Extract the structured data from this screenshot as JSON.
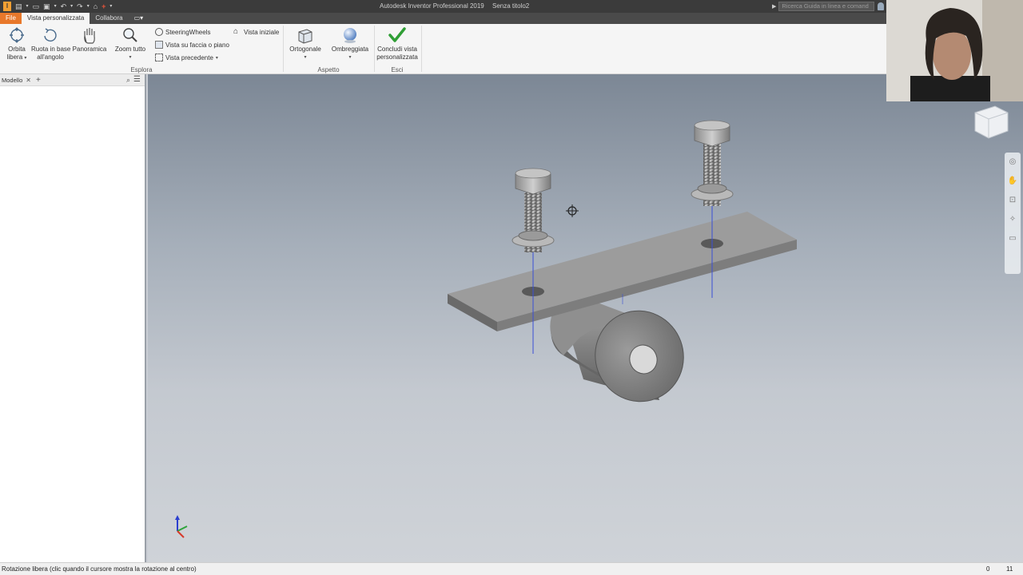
{
  "titlebar": {
    "app_logo": "I",
    "app_title": "Autodesk Inventor Professional 2019",
    "doc_title": "Senza titolo2",
    "help_search_placeholder": "Ricerca Guida in linea e comand"
  },
  "tabs": {
    "file": "File",
    "active": "Vista personalizzata",
    "collabora": "Collabora"
  },
  "ribbon": {
    "orbita": [
      "Orbita",
      "libera"
    ],
    "ruota": [
      "Ruota in base",
      "all'angolo"
    ],
    "panoramica": "Panoramica",
    "zoom_tutto": "Zoom tutto",
    "steering": "SteeringWheels",
    "vista_faccia": "Vista su faccia o piano",
    "vista_precedente": "Vista precedente",
    "vista_iniziale": "Vista iniziale",
    "ortogonale": "Ortogonale",
    "ombreggiata": "Ombreggiata",
    "concludi": [
      "Concludi vista",
      "personalizzata"
    ],
    "group_esplora": "Esplora",
    "group_aspetto": "Aspetto",
    "group_esci": "Esci"
  },
  "browser": {
    "tab_label": "Modello"
  },
  "statusbar": {
    "text": "Rotazione libera (clic quando il cursore mostra la rotazione al centro)",
    "count1": "0",
    "count2": "11"
  },
  "colors": {
    "accent_file_tab": "#e8782b",
    "check_green": "#2f9e35",
    "axis_blue": "#3a4fd6"
  }
}
